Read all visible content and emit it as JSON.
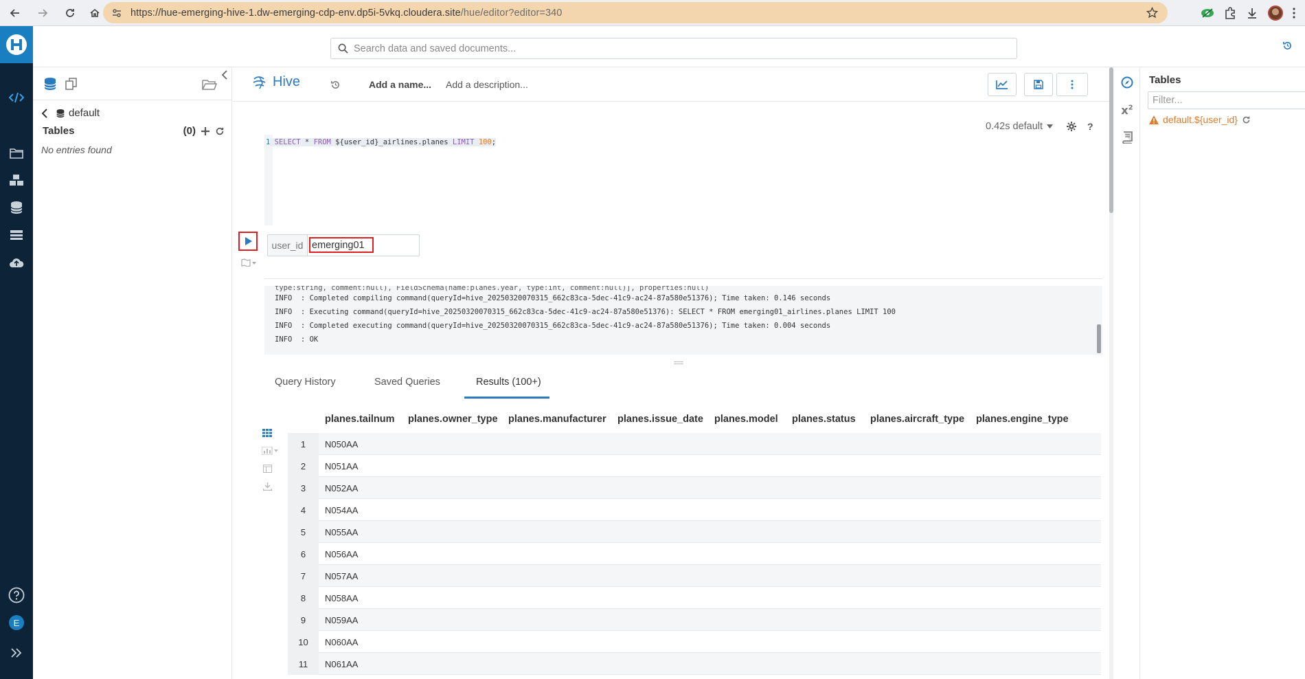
{
  "browser": {
    "url_main": "https://hue-emerging-hive-1.dw-emerging-cdp-env.dp5i-5vkq.cloudera.site",
    "url_path": "/hue/editor?editor=340"
  },
  "topbar": {
    "search_placeholder": "Search data and saved documents..."
  },
  "assist": {
    "database": "default",
    "tables_label": "Tables",
    "tables_count": "(0)",
    "empty_text": "No entries found"
  },
  "editor": {
    "type_label": "Hive",
    "add_name": "Add a name...",
    "add_description": "Add a description...",
    "exec_info": "0.42s default",
    "code": {
      "line_number": "1",
      "kw_select": "SELECT",
      "star_from": " * ",
      "kw_from": "FROM",
      "table_ref": " ${user_id}_airlines.planes ",
      "kw_limit": "LIMIT",
      "limit_value": "100",
      "semicolon": ";"
    },
    "param": {
      "label": "user_id",
      "value": "emerging01"
    },
    "logs": [
      "type:string, comment:null), FieldSchema(name:planes.year, type:int, comment:null)], properties:null)",
      "INFO  : Completed compiling command(queryId=hive_20250320070315_662c83ca-5dec-41c9-ac24-87a580e51376); Time taken: 0.146 seconds",
      "INFO  : Executing command(queryId=hive_20250320070315_662c83ca-5dec-41c9-ac24-87a580e51376): SELECT * FROM emerging01_airlines.planes LIMIT 100",
      "INFO  : Completed executing command(queryId=hive_20250320070315_662c83ca-5dec-41c9-ac24-87a580e51376); Time taken: 0.004 seconds",
      "INFO  : OK"
    ],
    "tabs": [
      "Query History",
      "Saved Queries",
      "Results (100+)"
    ]
  },
  "results": {
    "columns": [
      "planes.tailnum",
      "planes.owner_type",
      "planes.manufacturer",
      "planes.issue_date",
      "planes.model",
      "planes.status",
      "planes.aircraft_type",
      "planes.engine_type"
    ],
    "rows": [
      [
        "1",
        "N050AA"
      ],
      [
        "2",
        "N051AA"
      ],
      [
        "3",
        "N052AA"
      ],
      [
        "4",
        "N054AA"
      ],
      [
        "5",
        "N055AA"
      ],
      [
        "6",
        "N056AA"
      ],
      [
        "7",
        "N057AA"
      ],
      [
        "8",
        "N058AA"
      ],
      [
        "9",
        "N059AA"
      ],
      [
        "10",
        "N060AA"
      ],
      [
        "11",
        "N061AA"
      ]
    ]
  },
  "right_panel": {
    "title": "Tables",
    "filter_placeholder": "Filter...",
    "warning_item": "default.${user_id}"
  },
  "user": {
    "initial": "E"
  },
  "colors": {
    "rail": "#0d2438",
    "brand": "#1a7fc1",
    "accent": "#2a7bc0",
    "warning": "#e07b2b",
    "highlight": "#e02020"
  }
}
